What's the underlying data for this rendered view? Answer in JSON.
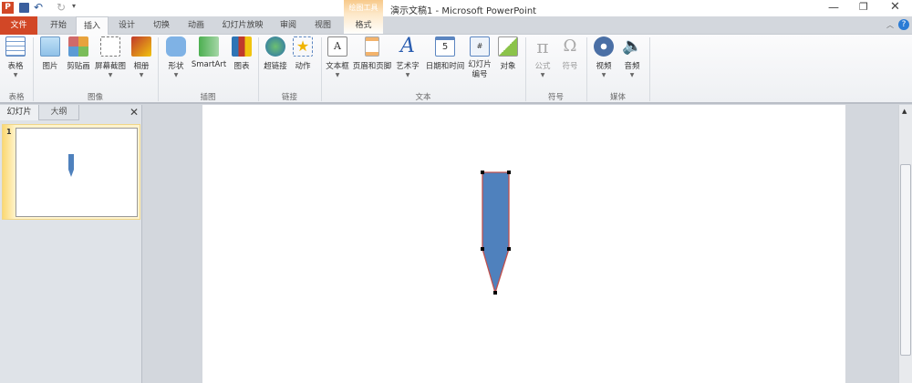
{
  "window": {
    "title": "演示文稿1 - Microsoft PowerPoint",
    "context_tab_group": "绘图工具"
  },
  "tabs": [
    "文件",
    "开始",
    "插入",
    "设计",
    "切换",
    "动画",
    "幻灯片放映",
    "审阅",
    "视图",
    "格式"
  ],
  "ribbon": {
    "buttons": [
      "表格",
      "图片",
      "剪贴画",
      "屏幕截图",
      "相册",
      "形状",
      "SmartArt",
      "图表",
      "超链接",
      "动作",
      "文本框",
      "页眉和页脚",
      "艺术字",
      "日期和时间",
      "幻灯片编号",
      "对象",
      "公式",
      "符号",
      "视频",
      "音频"
    ],
    "groups": [
      "表格",
      "图像",
      "插图",
      "链接",
      "文本",
      "符号",
      "媒体"
    ]
  },
  "panel": {
    "tabs": [
      "幻灯片",
      "大纲"
    ],
    "slide_number": "1"
  },
  "colors": {
    "shape_fill": "#4f81bd",
    "shape_stroke": "#c0504d",
    "file_tab": "#d24726"
  }
}
